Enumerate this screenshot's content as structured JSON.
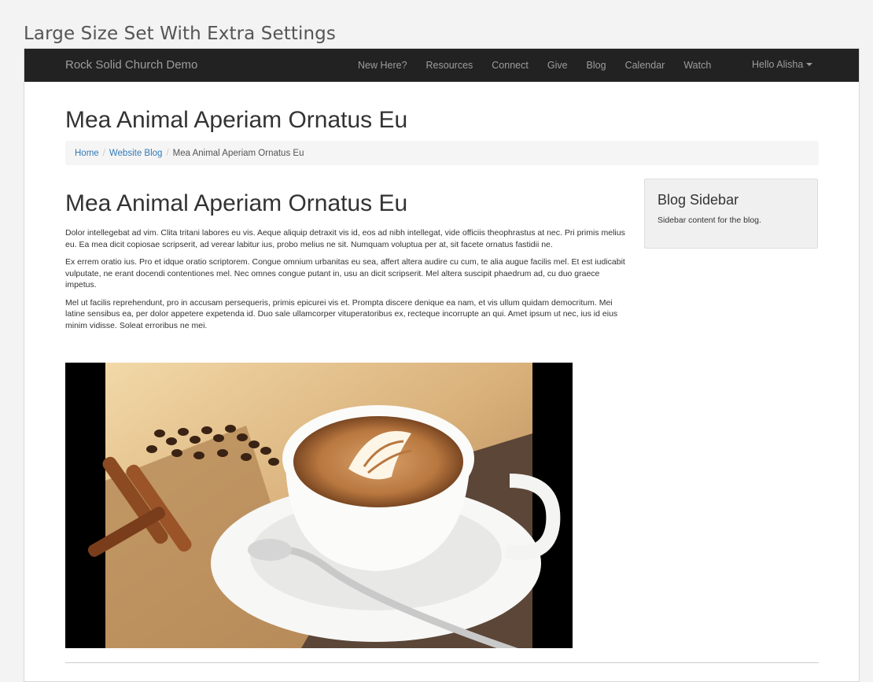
{
  "caption": "Large Size Set With Extra Settings",
  "navbar": {
    "brand": "Rock Solid Church Demo",
    "items": [
      "New Here?",
      "Resources",
      "Connect",
      "Give",
      "Blog",
      "Calendar",
      "Watch"
    ],
    "user": "Hello Alisha"
  },
  "page": {
    "title": "Mea Animal Aperiam Ornatus Eu",
    "breadcrumb": [
      "Home",
      "Website Blog",
      "Mea Animal Aperiam Ornatus Eu"
    ]
  },
  "post": {
    "title": "Mea Animal Aperiam Ornatus Eu",
    "paragraphs": [
      "Dolor intellegebat ad vim. Clita tritani labores eu vis. Aeque aliquip detraxit vis id, eos ad nibh intellegat, vide officiis theophrastus at nec. Pri primis melius eu. Ea mea dicit copiosae scripserit, ad verear labitur ius, probo melius ne sit. Numquam voluptua per at, sit facete ornatus fastidii ne.",
      "Ex errem oratio ius. Pro et idque oratio scriptorem. Congue omnium urbanitas eu sea, affert altera audire cu cum, te alia augue facilis mel. Et est iudicabit vulputate, ne erant docendi contentiones mel. Nec omnes congue putant in, usu an dicit scripserit. Mel altera suscipit phaedrum ad, cu duo graece impetus.",
      "Mel ut facilis reprehendunt, pro in accusam persequeris, primis epicurei vis et. Prompta discere denique ea nam, et vis ullum quidam democritum. Mei latine sensibus ea, per dolor appetere expetenda id. Duo sale ullamcorper vituperatoribus ex, recteque incorrupte an qui. Amet ipsum ut nec, ius id eius minim vidisse. Soleat erroribus ne mei."
    ]
  },
  "sidebar": {
    "title": "Blog Sidebar",
    "text": "Sidebar content for the blog."
  }
}
